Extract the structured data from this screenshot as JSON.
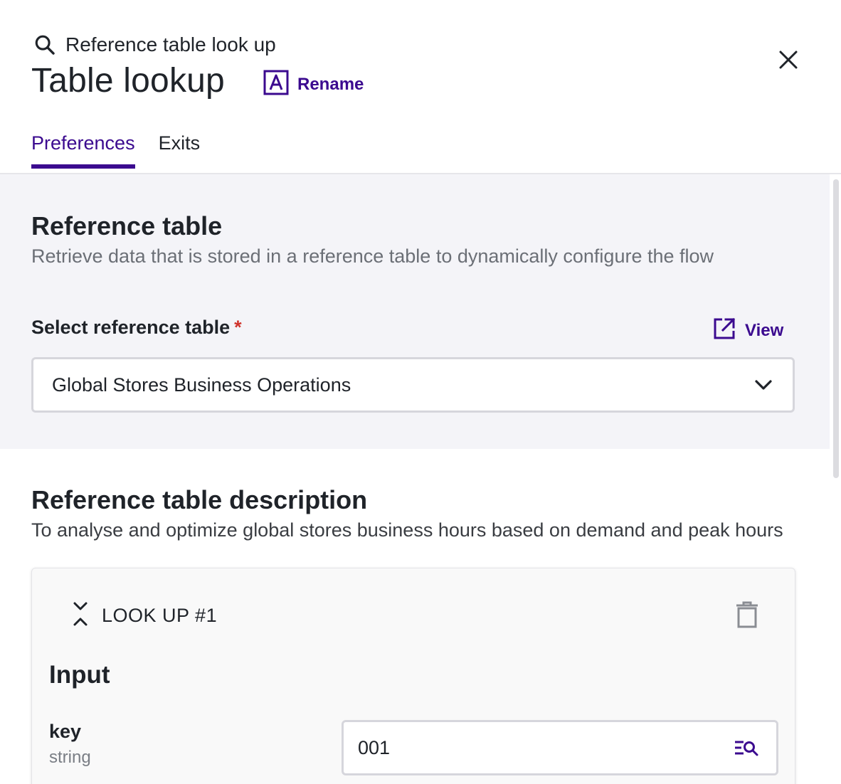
{
  "header": {
    "breadcrumb": "Reference table look up",
    "title": "Table lookup",
    "rename_label": "Rename"
  },
  "tabs": [
    {
      "label": "Preferences",
      "active": true
    },
    {
      "label": "Exits",
      "active": false
    }
  ],
  "reference_table": {
    "title": "Reference table",
    "subtitle": "Retrieve data that is stored in a reference table to dynamically configure the flow",
    "select_label": "Select reference table",
    "required_mark": "*",
    "view_label": "View",
    "selected_value": "Global Stores Business Operations"
  },
  "description": {
    "title": "Reference table description",
    "text": "To analyse and optimize global stores business hours based on demand and peak hours"
  },
  "lookup": {
    "title": "LOOK UP #1",
    "input_title": "Input",
    "key_label": "key",
    "key_type": "string",
    "key_value": "001"
  },
  "colors": {
    "accent": "#3b0a8f",
    "required": "#d0342c",
    "section_bg": "#f4f4f8"
  },
  "icons": {
    "breadcrumb": "search-icon",
    "rename": "rename-icon",
    "close": "close-icon",
    "view": "external-link-icon",
    "select": "chevron-down-icon",
    "collapse": "collapse-icon",
    "delete": "trash-icon",
    "key_lookup": "list-search-icon"
  }
}
